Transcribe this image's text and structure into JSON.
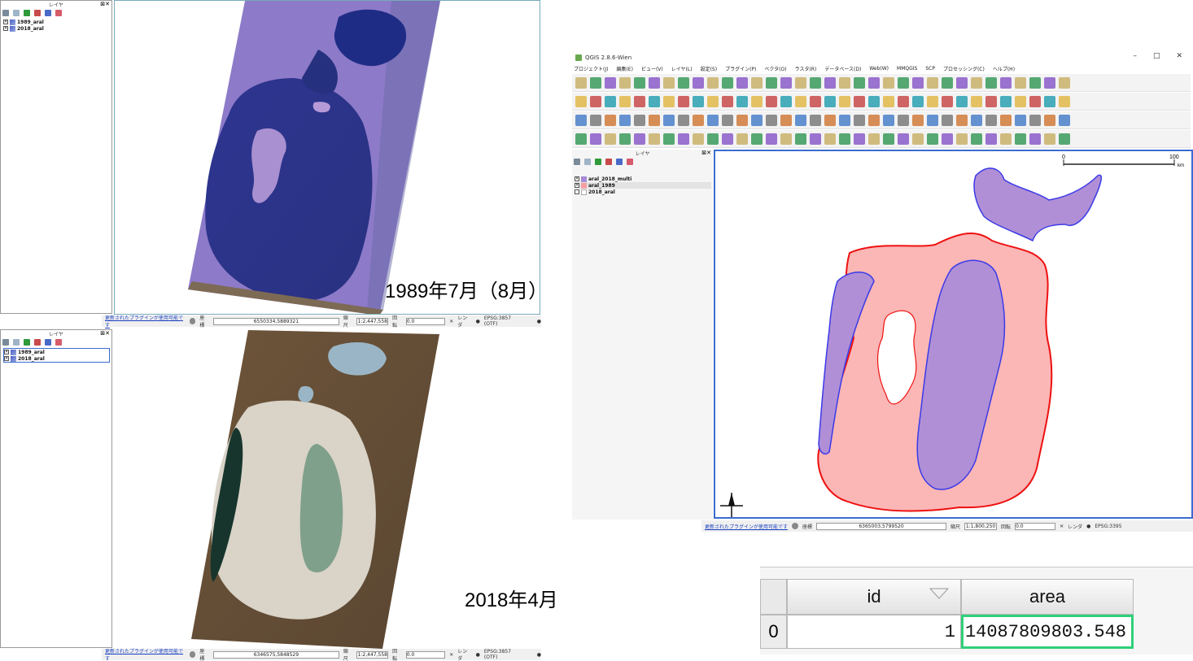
{
  "top_window": {
    "layers_title": "レイヤ",
    "layers": [
      {
        "name": "1989_aral",
        "checked": true
      },
      {
        "name": "2018_aral",
        "checked": true
      }
    ],
    "status": {
      "plugin_link": "更新されたプラグインが使用可能です",
      "coord_label": "座標",
      "coord_value": "6550334,5889321",
      "scale_label": "縮尺",
      "scale_value": "1:2,447,558",
      "rotation_label": "回転",
      "rotation_value": "0.0",
      "render_label": "レンダ",
      "crs": "EPSG:3857 (OTF)"
    }
  },
  "bottom_window": {
    "layers_title": "レイヤ",
    "layers": [
      {
        "name": "1989_aral",
        "checked": true
      },
      {
        "name": "2018_aral",
        "checked": true
      }
    ],
    "status": {
      "plugin_link": "更新されたプラグインが使用可能です",
      "coord_label": "座標",
      "coord_value": "6346575,5848529",
      "scale_label": "縮尺",
      "scale_value": "1:2,447,558",
      "rotation_label": "回転",
      "rotation_value": "0.0",
      "render_label": "レンダ",
      "crs": "EPSG:3857 (OTF)"
    }
  },
  "captions": {
    "top": "1989年7月（8月）",
    "bottom": "2018年4月"
  },
  "right_window": {
    "title": "QGIS 2.8.6-Wien",
    "menu": [
      "プロジェクト(J)",
      "編集(E)",
      "ビュー(V)",
      "レイヤ(L)",
      "設定(S)",
      "プラグイン(P)",
      "ベクタ(O)",
      "ラスタ(R)",
      "データベース(D)",
      "Web(W)",
      "MMQGIS",
      "SCP",
      "プロセッシング(C)",
      "ヘルプ(H)"
    ],
    "win_controls": [
      "–",
      "□",
      "✕"
    ],
    "layers_title": "レイヤ",
    "layers": [
      {
        "name": "aral_2018_multi",
        "color": "#a58ad6",
        "checked": true
      },
      {
        "name": "aral_1989",
        "color": "#f5a0a0",
        "checked": true
      },
      {
        "name": "2018_aral",
        "color": "#ffffff",
        "checked": false
      }
    ],
    "scalebar": {
      "start": "0",
      "end": "100",
      "unit": "km"
    },
    "status": {
      "plugin_link": "更新されたプラグインが使用可能です",
      "coord_label": "座標",
      "coord_value": "6365003,5799520",
      "scale_label": "縮尺",
      "scale_value": "1:1,800,250",
      "rotation_label": "回転",
      "rotation_value": "0.0",
      "render_label": "レンダ",
      "crs": "EPSG:3395"
    },
    "colors": {
      "poly_1989_fill": "#fbb6b6",
      "poly_1989_stroke": "#ee1010",
      "poly_2018_fill": "#b08fd6",
      "poly_2018_stroke": "#3a3ae8"
    }
  },
  "attribute_table": {
    "columns": [
      "id",
      "area"
    ],
    "rows": [
      {
        "row_header": "0",
        "id": "1",
        "area": "14087809803.548"
      }
    ],
    "selected_border": "#2fd07a"
  }
}
